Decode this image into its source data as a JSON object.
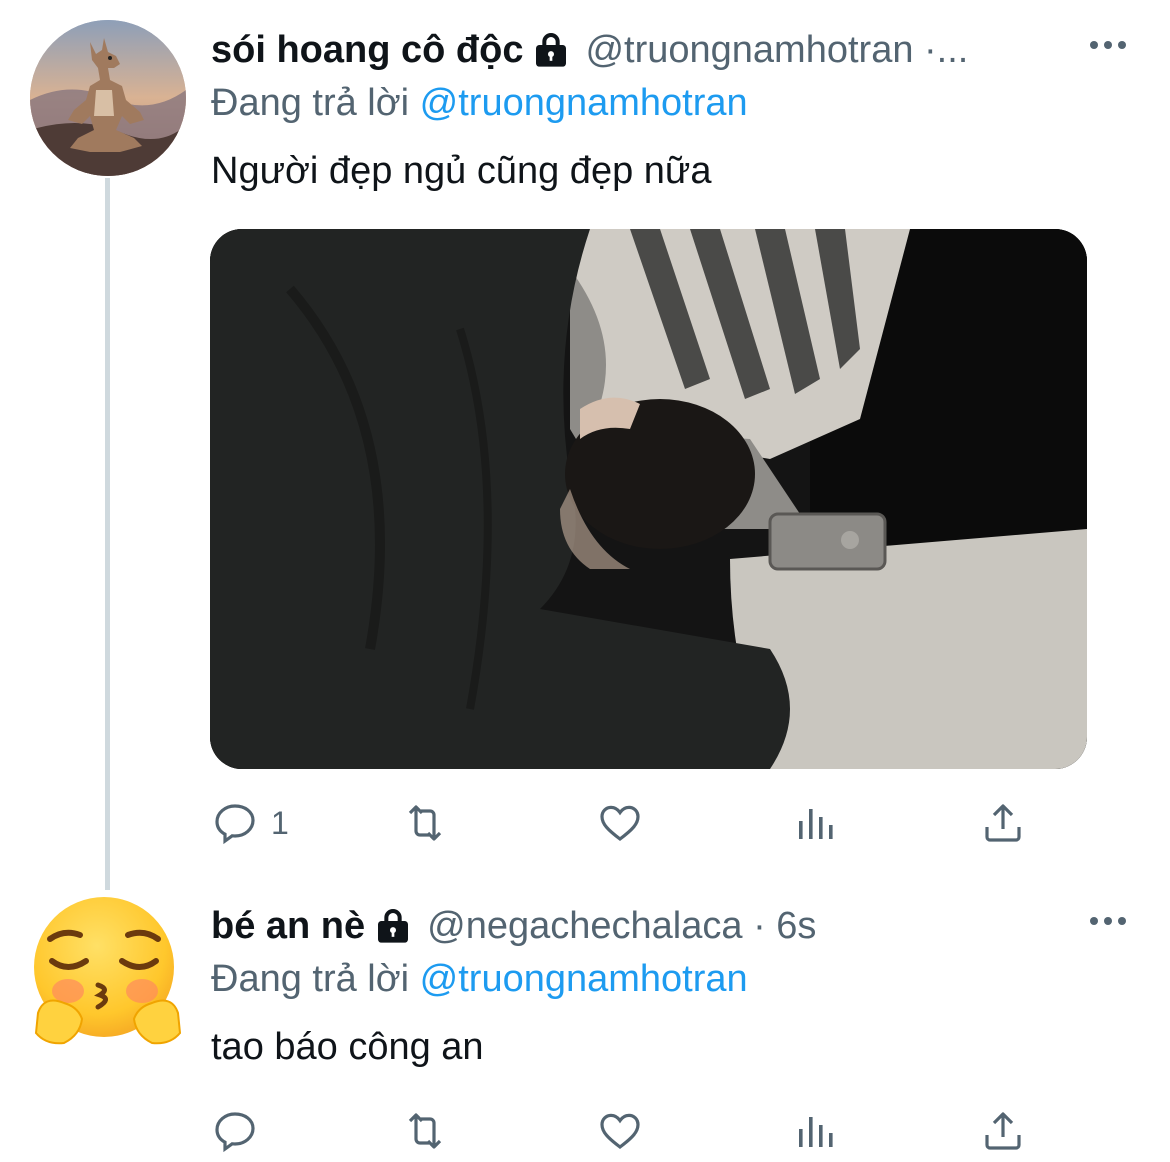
{
  "tweets": [
    {
      "display_name": "sói hoang cô độc",
      "handle": "@truongnamhotran ·...",
      "reply_prefix": "Đang trả lời",
      "reply_to": "@truongnamhotran",
      "text": "Người đẹp ngủ cũng đẹp nữa",
      "reply_count": "1",
      "avatar_icon": "wolf-meditating-avatar",
      "has_media": true
    },
    {
      "display_name": "bé an nè",
      "handle": "@negachechalaca · 6s",
      "reply_prefix": "Đang trả lời",
      "reply_to": "@truongnamhotran",
      "text": "tao báo công an",
      "reply_count": "",
      "avatar_icon": "pleading-kissing-emoji-avatar",
      "has_media": false
    }
  ],
  "colors": {
    "text_primary": "#0f1419",
    "text_secondary": "#536471",
    "accent": "#1d9bf0",
    "thread_line": "#cfd9de"
  }
}
